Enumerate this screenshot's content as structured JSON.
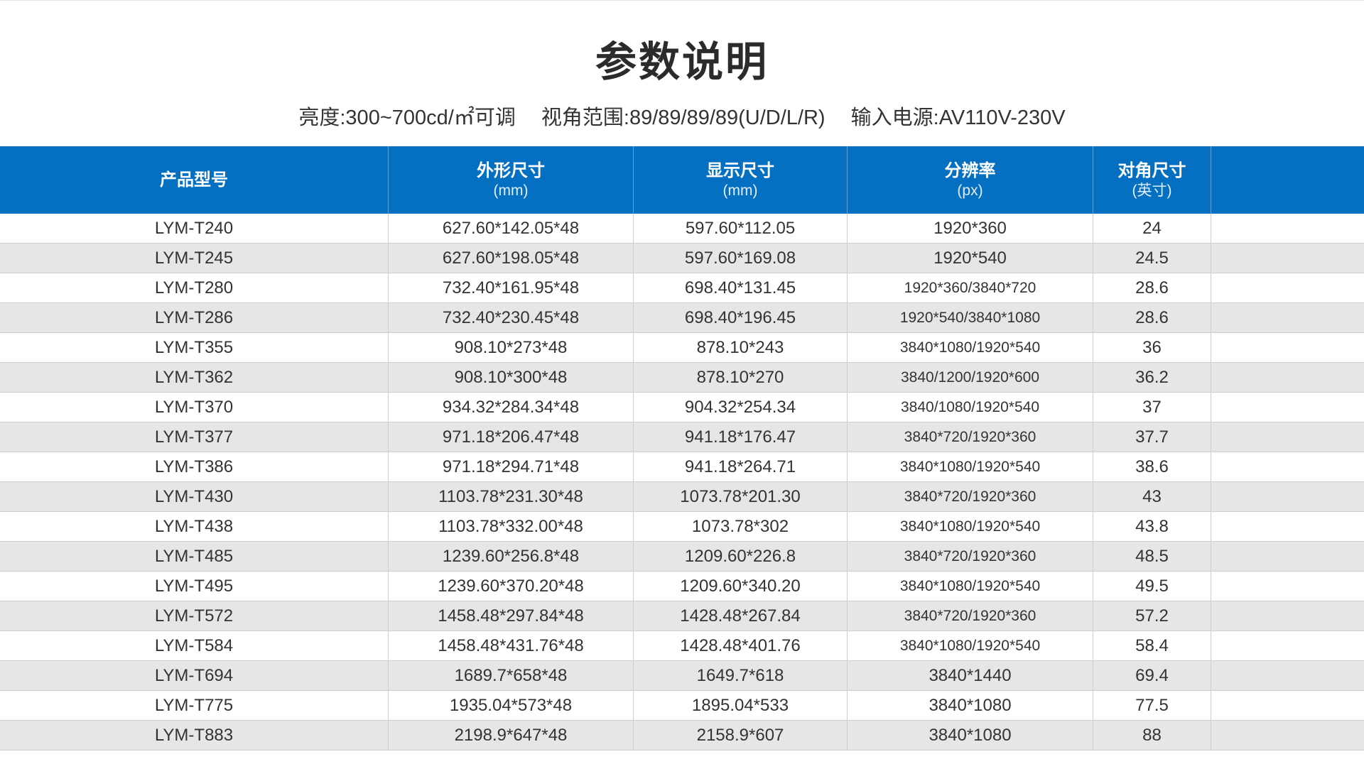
{
  "title": "参数说明",
  "specs": [
    "亮度:300~700cd/㎡可调",
    "视角范围:89/89/89/89(U/D/L/R)",
    "输入电源:AV110V-230V"
  ],
  "table": {
    "headers": [
      {
        "label": "产品型号",
        "unit": ""
      },
      {
        "label": "外形尺寸",
        "unit": "(mm)"
      },
      {
        "label": "显示尺寸",
        "unit": "(mm)"
      },
      {
        "label": "分辨率",
        "unit": "(px)"
      },
      {
        "label": "对角尺寸",
        "unit": "(英寸)"
      },
      {
        "label": "",
        "unit": ""
      }
    ],
    "rows": [
      [
        "LYM-T240",
        "627.60*142.05*48",
        "597.60*112.05",
        "1920*360",
        "24"
      ],
      [
        "LYM-T245",
        "627.60*198.05*48",
        "597.60*169.08",
        "1920*540",
        "24.5"
      ],
      [
        "LYM-T280",
        "732.40*161.95*48",
        "698.40*131.45",
        "1920*360/3840*720",
        "28.6"
      ],
      [
        "LYM-T286",
        "732.40*230.45*48",
        "698.40*196.45",
        "1920*540/3840*1080",
        "28.6"
      ],
      [
        "LYM-T355",
        "908.10*273*48",
        "878.10*243",
        "3840*1080/1920*540",
        "36"
      ],
      [
        "LYM-T362",
        "908.10*300*48",
        "878.10*270",
        "3840/1200/1920*600",
        "36.2"
      ],
      [
        "LYM-T370",
        "934.32*284.34*48",
        "904.32*254.34",
        "3840/1080/1920*540",
        "37"
      ],
      [
        "LYM-T377",
        "971.18*206.47*48",
        "941.18*176.47",
        "3840*720/1920*360",
        "37.7"
      ],
      [
        "LYM-T386",
        "971.18*294.71*48",
        "941.18*264.71",
        "3840*1080/1920*540",
        "38.6"
      ],
      [
        "LYM-T430",
        "1103.78*231.30*48",
        "1073.78*201.30",
        "3840*720/1920*360",
        "43"
      ],
      [
        "LYM-T438",
        "1103.78*332.00*48",
        "1073.78*302",
        "3840*1080/1920*540",
        "43.8"
      ],
      [
        "LYM-T485",
        "1239.60*256.8*48",
        "1209.60*226.8",
        "3840*720/1920*360",
        "48.5"
      ],
      [
        "LYM-T495",
        "1239.60*370.20*48",
        "1209.60*340.20",
        "3840*1080/1920*540",
        "49.5"
      ],
      [
        "LYM-T572",
        "1458.48*297.84*48",
        "1428.48*267.84",
        "3840*720/1920*360",
        "57.2"
      ],
      [
        "LYM-T584",
        "1458.48*431.76*48",
        "1428.48*401.76",
        "3840*1080/1920*540",
        "58.4"
      ],
      [
        "LYM-T694",
        "1689.7*658*48",
        "1649.7*618",
        "3840*1440",
        "69.4"
      ],
      [
        "LYM-T775",
        "1935.04*573*48",
        "1895.04*533",
        "3840*1080",
        "77.5"
      ],
      [
        "LYM-T883",
        "2198.9*647*48",
        "2158.9*607",
        "3840*1080",
        "88"
      ]
    ]
  },
  "colors": {
    "header_bg": "#0570c1",
    "alt_row_bg": "#e6e6e6"
  }
}
